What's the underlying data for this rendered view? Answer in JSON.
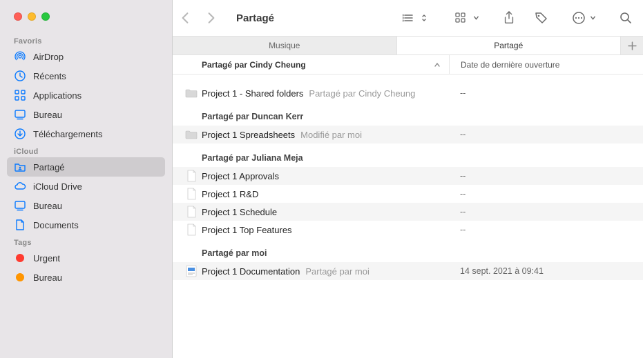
{
  "window": {
    "title": "Partagé"
  },
  "sidebar": {
    "sections": [
      {
        "heading": "Favoris",
        "items": [
          {
            "label": "AirDrop",
            "icon": "airdrop",
            "selected": false
          },
          {
            "label": "Récents",
            "icon": "clock",
            "selected": false
          },
          {
            "label": "Applications",
            "icon": "grid",
            "selected": false
          },
          {
            "label": "Bureau",
            "icon": "desktop",
            "selected": false
          },
          {
            "label": "Téléchargements",
            "icon": "download",
            "selected": false
          }
        ]
      },
      {
        "heading": "iCloud",
        "items": [
          {
            "label": "Partagé",
            "icon": "shared-folder",
            "selected": true
          },
          {
            "label": "iCloud Drive",
            "icon": "cloud",
            "selected": false
          },
          {
            "label": "Bureau",
            "icon": "desktop",
            "selected": false
          },
          {
            "label": "Documents",
            "icon": "document",
            "selected": false
          }
        ]
      },
      {
        "heading": "Tags",
        "items": [
          {
            "label": "Urgent",
            "icon": "tag",
            "color": "#ff3b30",
            "selected": false
          },
          {
            "label": "Bureau",
            "icon": "tag",
            "color": "#ff9500",
            "selected": false
          }
        ]
      }
    ]
  },
  "tabs": {
    "items": [
      {
        "label": "Musique",
        "active": false
      },
      {
        "label": "Partagé",
        "active": true
      }
    ]
  },
  "columns": {
    "name_grouped_by": "Partagé par Cindy Cheung",
    "date": "Date de dernière ouverture"
  },
  "groups": [
    {
      "label": "",
      "rows": [
        {
          "icon": "folder",
          "name": "Project 1 - Shared folders",
          "meta": "Partagé par Cindy Cheung",
          "date": "--",
          "striped": false
        }
      ]
    },
    {
      "label": "Partagé par Duncan Kerr",
      "rows": [
        {
          "icon": "folder",
          "name": "Project 1 Spreadsheets",
          "meta": "Modifié par moi",
          "date": "--",
          "striped": true
        }
      ]
    },
    {
      "label": "Partagé par Juliana Meja",
      "rows": [
        {
          "icon": "doc",
          "name": "Project 1 Approvals",
          "meta": "",
          "date": "--",
          "striped": true
        },
        {
          "icon": "doc",
          "name": "Project 1 R&D",
          "meta": "",
          "date": "--",
          "striped": false
        },
        {
          "icon": "doc",
          "name": "Project 1 Schedule",
          "meta": "",
          "date": "--",
          "striped": true
        },
        {
          "icon": "doc",
          "name": "Project 1 Top Features",
          "meta": "",
          "date": "--",
          "striped": false
        }
      ]
    },
    {
      "label": "Partagé par moi",
      "rows": [
        {
          "icon": "presentation",
          "name": "Project 1 Documentation",
          "meta": "Partagé par moi",
          "date": "14 sept. 2021 à 09:41",
          "striped": true
        }
      ]
    }
  ]
}
